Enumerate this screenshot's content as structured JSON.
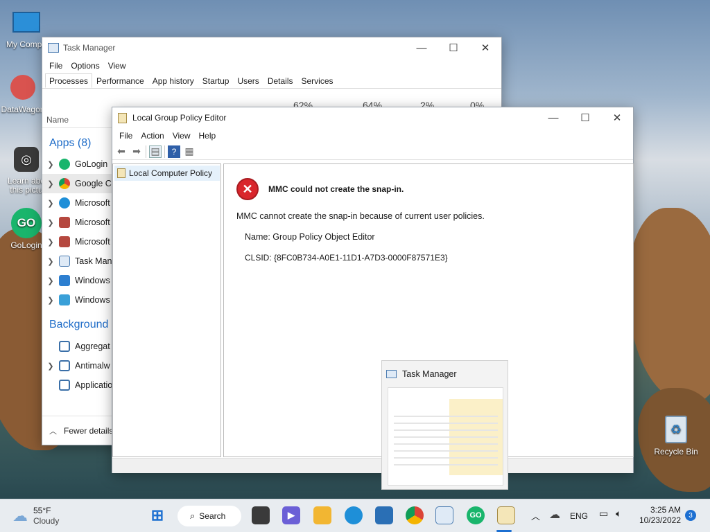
{
  "desktop": {
    "icons": [
      {
        "label": "My Compu"
      },
      {
        "label": "DataWagon"
      },
      {
        "label": "Learn abo this pictu"
      },
      {
        "label": "GoLogin"
      },
      {
        "label": "Recycle Bin"
      }
    ]
  },
  "task_manager": {
    "title": "Task Manager",
    "menu": [
      "File",
      "Options",
      "View"
    ],
    "tabs": [
      "Processes",
      "Performance",
      "App history",
      "Startup",
      "Users",
      "Details",
      "Services"
    ],
    "active_tab": "Processes",
    "column_name": "Name",
    "percents": [
      "62%",
      "64%",
      "2%",
      "0%"
    ],
    "apps_group": "Apps (8)",
    "apps": [
      "GoLogin",
      "Google C",
      "Microsoft",
      "Microsoft",
      "Microsoft",
      "Task Mana",
      "Windows",
      "Windows"
    ],
    "bg_group": "Background p",
    "bg": [
      "Aggregat",
      "Antimalw",
      "Applicatio"
    ],
    "fewer_details": "Fewer details"
  },
  "gpedit": {
    "title": "Local Group Policy Editor",
    "menu": [
      "File",
      "Action",
      "View",
      "Help"
    ],
    "tree_item": "Local Computer Policy",
    "error_title": "MMC could not create the snap-in.",
    "error_msg": "MMC cannot create the snap-in because of current user policies.",
    "name_line": "Name: Group Policy Object Editor",
    "clsid_line": "CLSID: {8FC0B734-A0E1-11D1-A7D3-0000F87571E3}"
  },
  "thumbnail": {
    "title": "Task Manager"
  },
  "taskbar": {
    "weather_temp": "55°F",
    "weather_desc": "Cloudy",
    "search_label": "Search",
    "lang": "ENG",
    "time": "3:25 AM",
    "date": "10/23/2022",
    "notif_count": "3"
  }
}
